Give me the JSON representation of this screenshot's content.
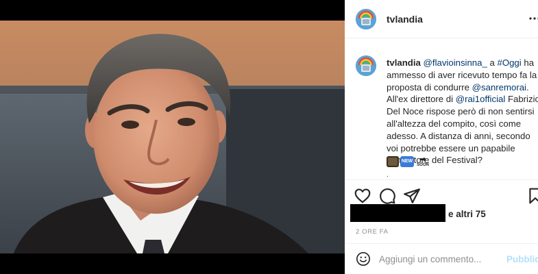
{
  "post": {
    "header": {
      "username": "tvlandia",
      "more_icon": "more-horizontal-icon"
    },
    "caption": {
      "username": "tvlandia",
      "segments": [
        {
          "text": "@flavioinsinna_",
          "tag": true
        },
        {
          "text": " a ",
          "tag": false
        },
        {
          "text": "#Oggi",
          "tag": true
        },
        {
          "text": " ha ammesso di aver ricevuto tempo fa la proposta di condurre ",
          "tag": false
        },
        {
          "text": "@sanremorai",
          "tag": true
        },
        {
          "text": ". All'ex direttore di ",
          "tag": false
        },
        {
          "text": "@rai1official",
          "tag": true
        },
        {
          "text": " Fabrizio Del Noce rispose però di non sentirsi all'altezza del compito, così come adesso. A distanza di anni, secondo voi potrebbe essere un papabile conduttore del Festival?",
          "tag": false
        }
      ],
      "emojis": {
        "tv": "television-emoji",
        "new": "NEW",
        "soon_arrow": "➡",
        "soon": "SOON"
      },
      "more": "."
    },
    "actions": {
      "like_icon": "heart-icon",
      "comment_icon": "comment-icon",
      "share_icon": "paper-plane-icon",
      "save_icon": "bookmark-icon"
    },
    "likes_text": "e altri 75",
    "timestamp": "2 ORE FA",
    "comment_bar": {
      "emoji_icon": "smiley-icon",
      "placeholder": "Aggiungi un commento...",
      "publish_label": "Pubblica"
    }
  },
  "colors": {
    "link": "#00376b",
    "publish_disabled": "#b2dffc",
    "muted": "#8e8e8e",
    "text": "#262626"
  }
}
